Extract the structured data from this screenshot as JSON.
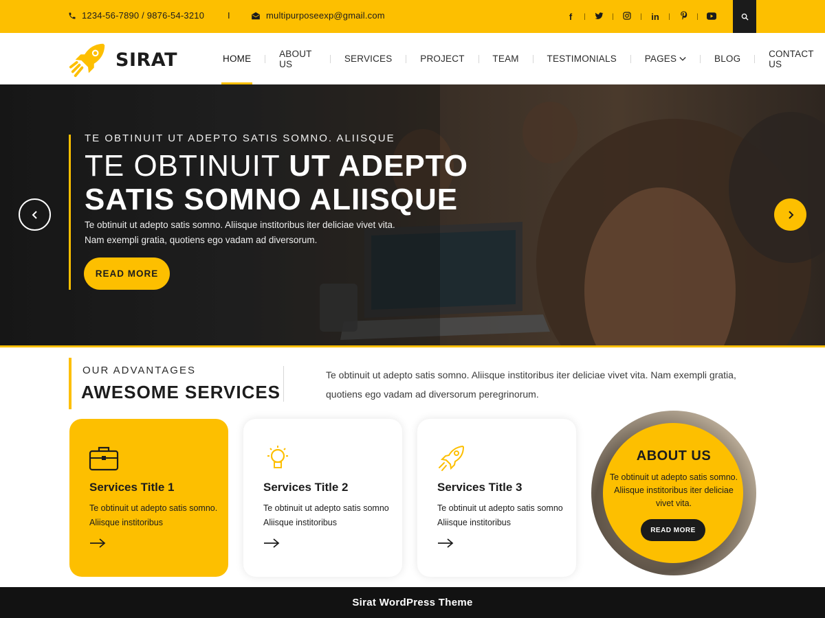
{
  "colors": {
    "accent": "#fdbf00",
    "dark": "#1b1b1b"
  },
  "topbar": {
    "phone": "1234-56-7890 / 9876-54-3210",
    "separator": "I",
    "email": "multipurposeexp@gmail.com",
    "social_icons": [
      "facebook-icon",
      "twitter-icon",
      "instagram-icon",
      "linkedin-icon",
      "pinterest-icon",
      "youtube-icon"
    ]
  },
  "header": {
    "logo_text": "SIRAT",
    "nav": [
      {
        "label": "HOME"
      },
      {
        "label": "ABOUT US"
      },
      {
        "label": "SERVICES"
      },
      {
        "label": "PROJECT"
      },
      {
        "label": "TEAM"
      },
      {
        "label": "TESTIMONIALS"
      },
      {
        "label": "PAGES"
      },
      {
        "label": "BLOG"
      },
      {
        "label": "CONTACT US"
      }
    ]
  },
  "hero": {
    "kicker": "TE OBTINUIT UT ADEPTO SATIS SOMNO. ALIISQUE",
    "title_light": "TE OBTINUIT",
    "title_bold": "UT ADEPTO",
    "title_line2": "SATIS SOMNO ALIISQUE",
    "description": "Te obtinuit ut adepto satis somno. Aliisque institoribus iter deliciae vivet vita. Nam exempli gratia, quotiens ego vadam ad diversorum.",
    "button": "READ MORE"
  },
  "services": {
    "kicker": "OUR ADVANTAGES",
    "title": "AWESOME SERVICES",
    "description": "Te obtinuit ut adepto satis somno. Aliisque institoribus iter deliciae vivet vita. Nam exempli gratia, quotiens ego vadam ad diversorum peregrinorum.",
    "cards": [
      {
        "icon": "briefcase-icon",
        "title": "Services Title 1",
        "text": "Te obtinuit ut adepto satis somno. Aliisque institoribus"
      },
      {
        "icon": "lightbulb-icon",
        "title": "Services Title 2",
        "text": "Te obtinuit ut adepto satis somno Aliisque institoribus"
      },
      {
        "icon": "rocket-icon",
        "title": "Services Title 3",
        "text": "Te obtinuit ut adepto satis somno Aliisque institoribus"
      }
    ]
  },
  "about": {
    "title": "ABOUT US",
    "text": "Te obtinuit ut adepto satis somno. Aliisque institoribus iter deliciae vivet vita.",
    "button": "READ MORE"
  },
  "footer": {
    "text": "Sirat WordPress Theme"
  }
}
